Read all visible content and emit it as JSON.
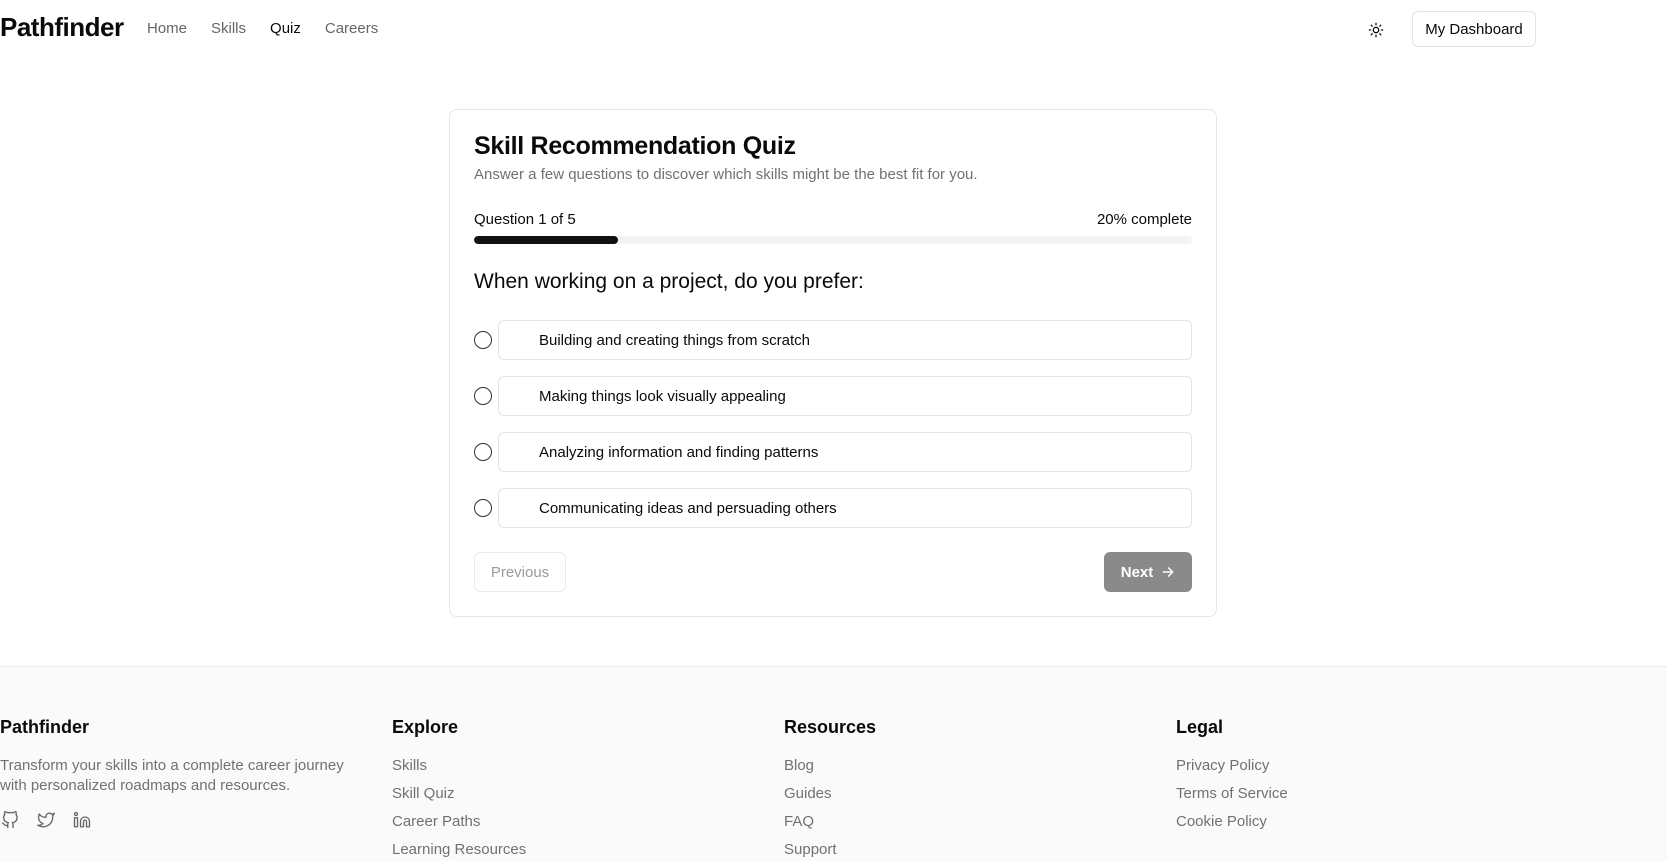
{
  "header": {
    "brand": "Pathfinder",
    "nav": [
      {
        "label": "Home"
      },
      {
        "label": "Skills"
      },
      {
        "label": "Quiz"
      },
      {
        "label": "Careers"
      }
    ],
    "active_nav": "Quiz",
    "dashboard_label": "My Dashboard"
  },
  "quiz": {
    "title": "Skill Recommendation Quiz",
    "subtitle": "Answer a few questions to discover which skills might be the best fit for you.",
    "progress_label": "Question 1 of 5",
    "progress_pct_label": "20% complete",
    "progress_fraction": 0.2,
    "question": "When working on a project, do you prefer:",
    "options": [
      {
        "label": "Building and creating things from scratch"
      },
      {
        "label": "Making things look visually appealing"
      },
      {
        "label": "Analyzing information and finding patterns"
      },
      {
        "label": "Communicating ideas and persuading others"
      }
    ],
    "previous_label": "Previous",
    "next_label": "Next"
  },
  "footer": {
    "brand": "Pathfinder",
    "description": "Transform your skills into a complete career journey with personalized roadmaps and resources.",
    "social_icons": [
      "github-icon",
      "twitter-icon",
      "linkedin-icon"
    ],
    "explore": {
      "title": "Explore",
      "links": [
        "Skills",
        "Skill Quiz",
        "Career Paths",
        "Learning Resources"
      ]
    },
    "resources": {
      "title": "Resources",
      "links": [
        "Blog",
        "Guides",
        "FAQ",
        "Support"
      ]
    },
    "legal": {
      "title": "Legal",
      "links": [
        "Privacy Policy",
        "Terms of Service",
        "Cookie Policy"
      ]
    }
  },
  "colors": {
    "primary": "#111111",
    "muted_text": "#717171",
    "border": "#e4e4e4",
    "next_button_disabled": "#8a8a8a",
    "footer_bg": "#fafafa"
  }
}
